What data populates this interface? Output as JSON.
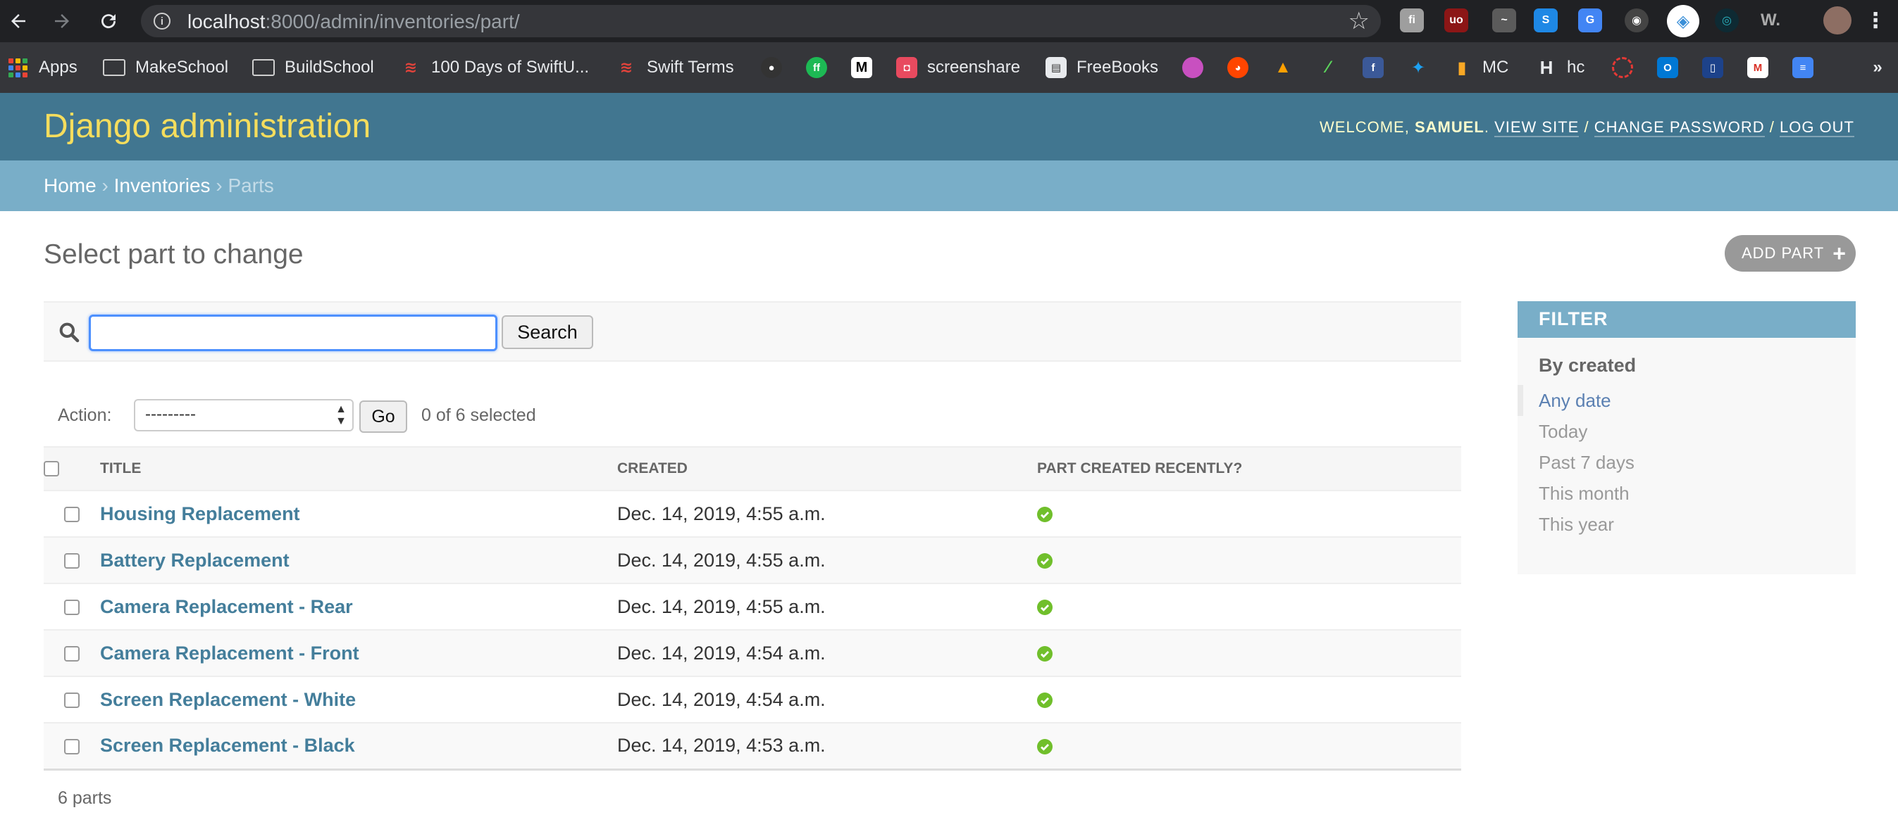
{
  "browser": {
    "url_host": "localhost",
    "url_rest": ":8000/admin/inventories/part/",
    "bookmarks": {
      "apps": "Apps",
      "makeschool": "MakeSchool",
      "buildschool": "BuildSchool",
      "swiftui": "100 Days of SwiftU...",
      "swift_terms": "Swift Terms",
      "screenshare": "screenshare",
      "freebooks": "FreeBooks",
      "mc": "MC",
      "hc": "hc"
    }
  },
  "header": {
    "branding": "Django administration",
    "welcome": "Welcome,",
    "username": "Samuel",
    "view_site": "View site",
    "change_password": "Change password",
    "log_out": "Log out"
  },
  "breadcrumbs": {
    "home": "Home",
    "app": "Inventories",
    "current": "Parts"
  },
  "content": {
    "title": "Select part to change",
    "add_button": "ADD PART",
    "search_button": "Search",
    "search_value": "",
    "action_label": "Action:",
    "action_selected": "---------",
    "go_button": "Go",
    "selection_counter": "0 of 6 selected",
    "columns": {
      "title": "Title",
      "created": "Created",
      "recent": "Part created recently?"
    },
    "rows": [
      {
        "title": "Housing Replacement",
        "created": "Dec. 14, 2019, 4:55 a.m.",
        "recent": true
      },
      {
        "title": "Battery Replacement",
        "created": "Dec. 14, 2019, 4:55 a.m.",
        "recent": true
      },
      {
        "title": "Camera Replacement - Rear",
        "created": "Dec. 14, 2019, 4:55 a.m.",
        "recent": true
      },
      {
        "title": "Camera Replacement - Front",
        "created": "Dec. 14, 2019, 4:54 a.m.",
        "recent": true
      },
      {
        "title": "Screen Replacement - White",
        "created": "Dec. 14, 2019, 4:54 a.m.",
        "recent": true
      },
      {
        "title": "Screen Replacement - Black",
        "created": "Dec. 14, 2019, 4:53 a.m.",
        "recent": true
      }
    ],
    "paginator": "6 parts"
  },
  "filter": {
    "heading": "Filter",
    "subheading": "By created",
    "options": [
      {
        "label": "Any date",
        "selected": true
      },
      {
        "label": "Today",
        "selected": false
      },
      {
        "label": "Past 7 days",
        "selected": false
      },
      {
        "label": "This month",
        "selected": false
      },
      {
        "label": "This year",
        "selected": false
      }
    ]
  },
  "colors": {
    "header_bg": "#417690",
    "breadcrumb_bg": "#79aec8",
    "branding": "#f5dd5d",
    "link": "#447e9b",
    "check_ok": "#70bf2b"
  }
}
